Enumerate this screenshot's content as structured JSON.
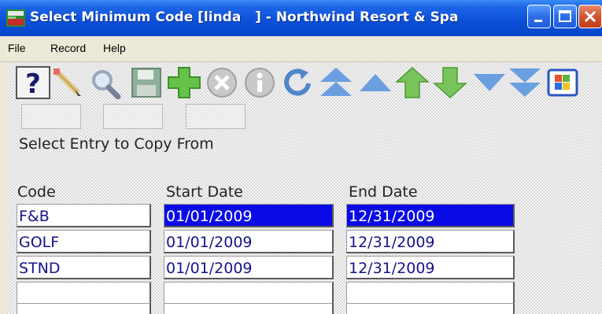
{
  "window": {
    "title": "Select Minimum Code [linda   ] - Northwind Resort & Spa"
  },
  "menu": [
    "File",
    "Record",
    "Help"
  ],
  "toolbar": {
    "icons": [
      "help-icon",
      "edit-icon",
      "search-icon",
      "save-icon",
      "add-icon",
      "delete-icon",
      "info-icon",
      "refresh-icon",
      "first-record-icon",
      "previous-record-icon",
      "up-icon",
      "down-icon",
      "next-record-icon",
      "last-record-icon",
      "windows-icon"
    ]
  },
  "form": {
    "heading": "Select Entry to Copy From",
    "columns": {
      "code": "Code",
      "start": "Start Date",
      "end": "End Date"
    },
    "rows": [
      {
        "code": "F&B",
        "start": "01/01/2009",
        "end": "12/31/2009"
      },
      {
        "code": "GOLF",
        "start": "01/01/2009",
        "end": "12/31/2009"
      },
      {
        "code": "STND",
        "start": "01/01/2009",
        "end": "12/31/2009"
      },
      {
        "code": "",
        "start": "",
        "end": ""
      },
      {
        "code": "",
        "start": "",
        "end": ""
      }
    ]
  },
  "colors": {
    "titlebar": "#0a4fd8",
    "selection": "#0a0ae8",
    "cell_text": "#14148c"
  }
}
